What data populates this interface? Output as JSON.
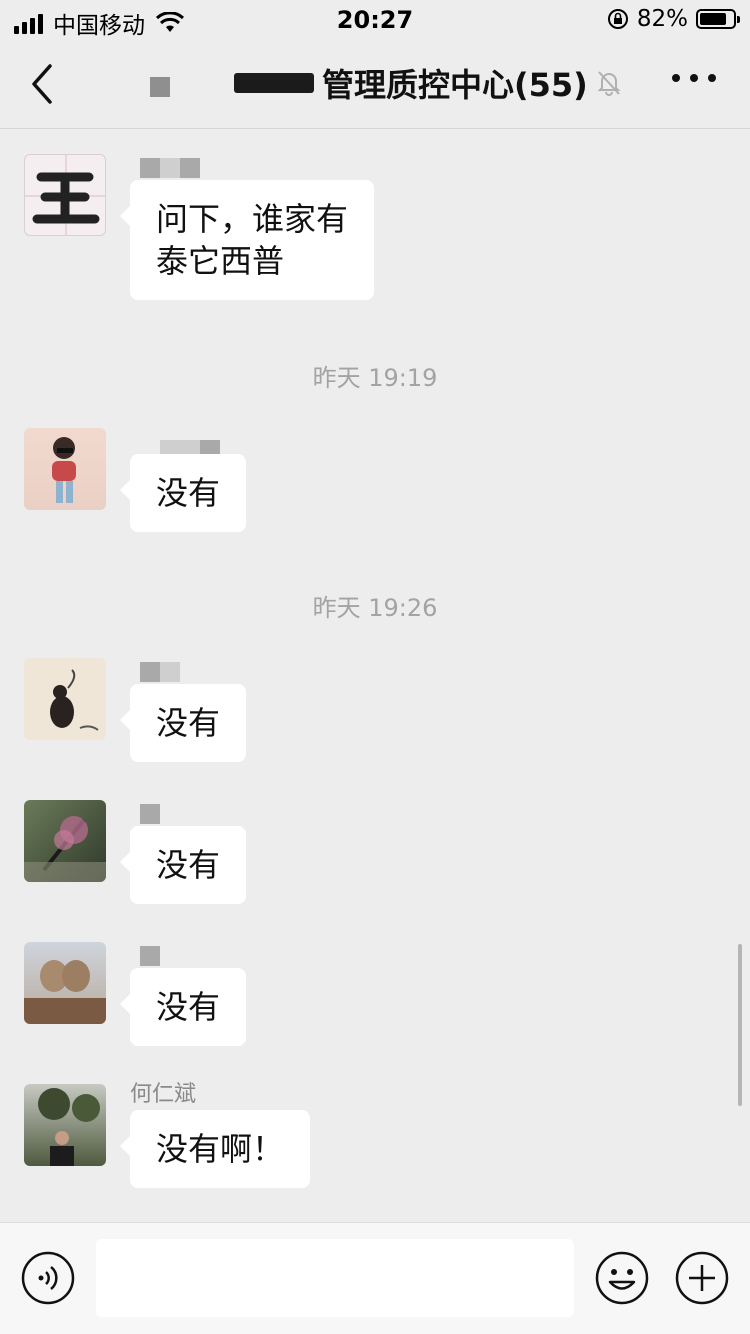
{
  "status_bar": {
    "carrier": "中国移动",
    "time": "20:27",
    "battery_percent": "82%",
    "battery_level": 0.82
  },
  "nav": {
    "title": "管理质控中心(55)",
    "back_icon": "chevron-left-icon",
    "mute_icon": "bell-slash-icon",
    "more_icon": "more-dots-icon"
  },
  "messages": [
    {
      "text_lines": [
        "问下，谁家有",
        "泰它西普"
      ]
    },
    {
      "text": "没有"
    },
    {
      "text": "没有"
    },
    {
      "text": "没有"
    },
    {
      "text": "没有"
    },
    {
      "sender": "何仁斌",
      "text": "没有啊！"
    }
  ],
  "timestamps": [
    "昨天 19:19",
    "昨天 19:26"
  ],
  "input_bar": {
    "voice_icon": "voice-icon",
    "emoji_icon": "emoji-icon",
    "plus_icon": "plus-icon",
    "placeholder": ""
  },
  "colors": {
    "background": "#ededed",
    "bubble": "#ffffff",
    "timestamp": "#a3a3a3"
  }
}
